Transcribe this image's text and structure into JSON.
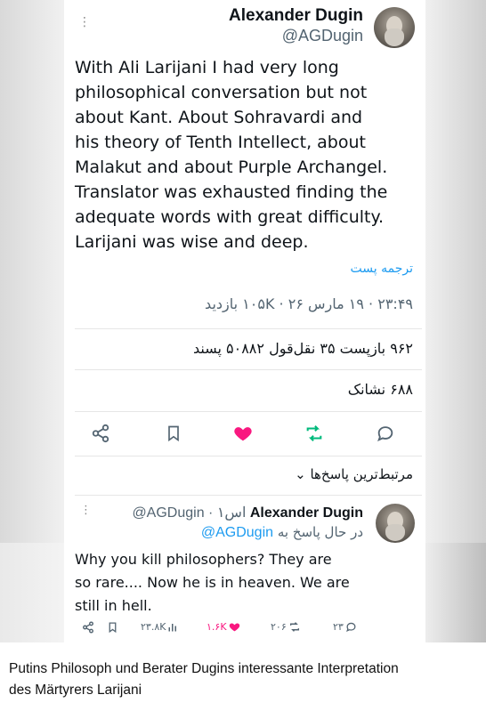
{
  "tweet": {
    "author_name": "Alexander Dugin",
    "author_handle": "@AGDugin",
    "body_lines": [
      "With Ali Larijani I had very long",
      "philosophical conversation but not",
      "about Kant. About Sohravardi and",
      "his theory of Tenth Intellect, about",
      "Malakut and about Purple Archangel.",
      "Translator was exhausted finding the",
      "adequate words with great difficulty.",
      "Larijani was wise and deep."
    ],
    "translate_label": "ترجمه پست",
    "meta": "۲۳:۴۹ · ۱۹ مارس ۲۶ · ۱۰۵K بازدید",
    "stats": "۹۶۲ بازپست  ۳۵ نقل‌قول  ۵۰۸۸۲ پسند",
    "bookmarks": "۶۸۸ نشانک"
  },
  "actions": {
    "share_icon": "share-icon",
    "bookmark_icon": "bookmark-icon",
    "like_icon": "heart-icon",
    "retweet_icon": "retweet-icon",
    "reply_icon": "reply-icon",
    "like_color": "#f91880",
    "retweet_color": "#00ba7c"
  },
  "sort_label": "مرتبط‌ترین پاسخ‌ها ⌄",
  "reply": {
    "author_name": "Alexander Dugin",
    "handle_time": "@AGDugin · ۱اس",
    "replying_to_label": "در حال پاسخ به",
    "replying_to_handle": "@AGDugin",
    "body_lines": [
      "Why you kill philosophers? They are",
      "so rare.... Now he is in heaven. We are",
      "still in hell."
    ],
    "views": "۲۳.۸K",
    "likes": "۱.۶K",
    "retweets": "۲۰۶",
    "replies": "۲۳"
  },
  "caption": {
    "line1": "Putins Philosoph und Berater Dugins interessante Interpretation",
    "line2": "des Märtyrers Larijani"
  }
}
